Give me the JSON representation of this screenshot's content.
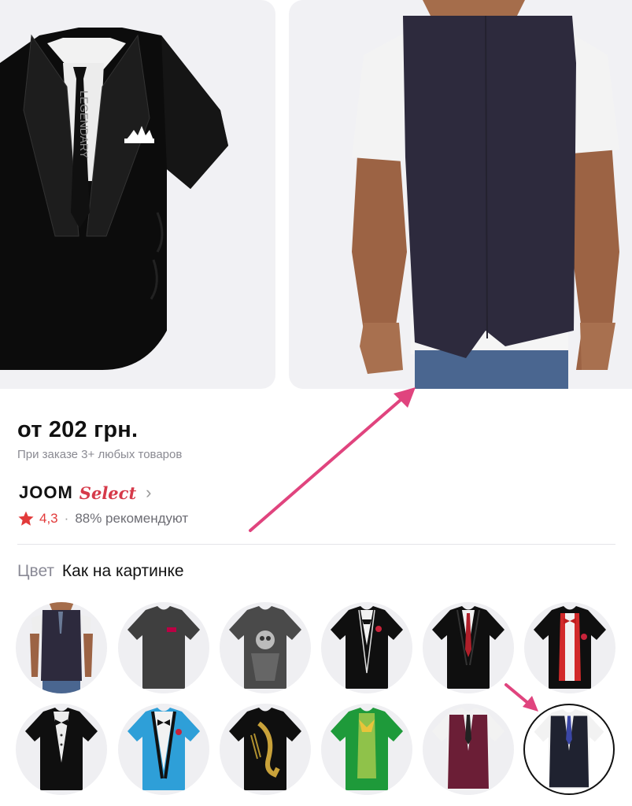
{
  "product": {
    "price": "от 202 грн.",
    "price_note": "При заказе 3+ любых товаров",
    "brand_primary": "JOOM",
    "brand_secondary": "Select",
    "rating_value": "4,3",
    "rating_separator": "·",
    "recommend_text": "88% рекомендуют",
    "tie_text": "LEGENDARY"
  },
  "color_section": {
    "label": "Цвет",
    "value": "Как на картинке"
  },
  "colors": {
    "accent_red": "#e23a3a",
    "annotation_pink": "#e0447e",
    "vest_purple": "#2d2a3d"
  },
  "swatches": [
    {
      "name": "man-purple-vest"
    },
    {
      "name": "dark-gray-tee"
    },
    {
      "name": "skull-print-tee"
    },
    {
      "name": "tuxedo-red-rose"
    },
    {
      "name": "suit-red-tie"
    },
    {
      "name": "red-vest-bowtie"
    },
    {
      "name": "black-tuxedo-bowtie"
    },
    {
      "name": "blue-tuxedo"
    },
    {
      "name": "saxophone-print"
    },
    {
      "name": "green-joker-suit"
    },
    {
      "name": "burgundy-vest"
    },
    {
      "name": "navy-vest-selected"
    }
  ]
}
